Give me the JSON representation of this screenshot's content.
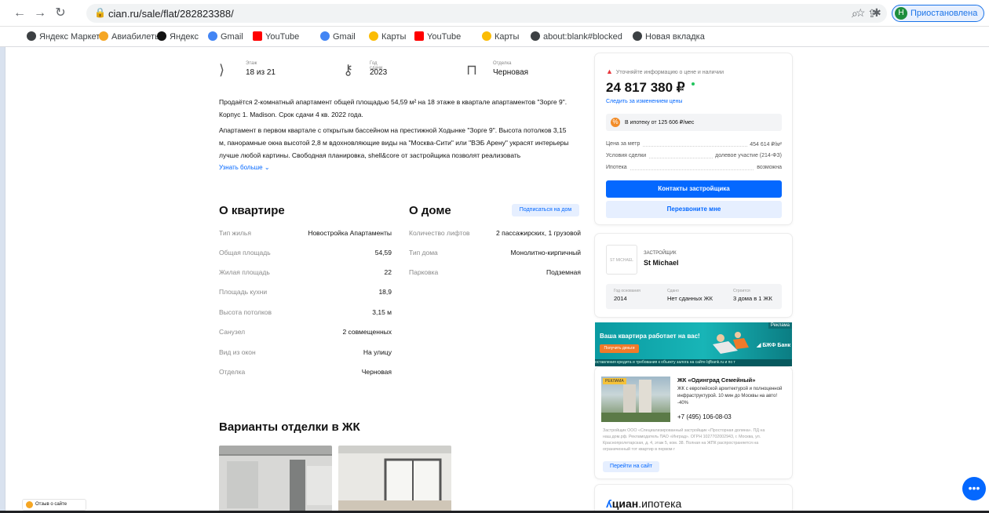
{
  "browser": {
    "url": "cian.ru/sale/flat/282823388/",
    "profile_initial": "Н",
    "profile_label": "Приостановлена",
    "bookmarks": [
      {
        "label": "Яндекс Маркет",
        "color": "#3c4043"
      },
      {
        "label": "Авиабилеты",
        "color": "#f5a623"
      },
      {
        "label": "Яндекс",
        "color": "#121212"
      },
      {
        "label": "Gmail",
        "color": "#4285f4"
      },
      {
        "label": "YouTube",
        "color": "#ff0000"
      },
      {
        "label": "Gmail",
        "color": "#4285f4"
      },
      {
        "label": "Карты",
        "color": "#fbbc04"
      },
      {
        "label": "YouTube",
        "color": "#ff0000"
      },
      {
        "label": "Карты",
        "color": "#fbbc04"
      },
      {
        "label": "about:blank#blocked",
        "color": "#3c4043"
      },
      {
        "label": "Новая вкладка",
        "color": "#3c4043"
      }
    ]
  },
  "specs": [
    {
      "key": "Этаж",
      "value": "18 из 21",
      "icon": "stairs-icon"
    },
    {
      "key": "Год сдачи",
      "value": "2023",
      "icon": "key-icon"
    },
    {
      "key": "Отделка",
      "value": "Черновая",
      "icon": "paint-roller-icon"
    }
  ],
  "description": {
    "p1": "Продаётся  2-комнатный апартамент  общей площадью 54,59 м² на 18 этаже в квартале апартаментов \"Зорге 9\". Корпус 1. Madison. Срок сдачи 4 кв. 2022 года.",
    "p2": "Апартамент в первом квартале с открытым бассейном на престижной Ходынке  \"Зорге 9\". Высота потолков 3,15 м, панорамные окна высотой 2,8 м  вдохновляющие виды на \"Москва-Сити\" или \"ВЭБ Арену\" украсят интерьеры лучше любой картины. Свободная планировка, shell&core от застройщика позволят реализовать",
    "more": "Узнать больше"
  },
  "apartment": {
    "title": "О квартире",
    "rows": [
      {
        "k": "Тип жилья",
        "v": "Новостройка Апартаменты"
      },
      {
        "k": "Общая площадь",
        "v": "54,59"
      },
      {
        "k": "Жилая площадь",
        "v": "22"
      },
      {
        "k": "Площадь кухни",
        "v": "18,9"
      },
      {
        "k": "Высота потолков",
        "v": "3,15 м"
      },
      {
        "k": "Санузел",
        "v": "2 совмещенных"
      },
      {
        "k": "Вид из окон",
        "v": "На улицу"
      },
      {
        "k": "Отделка",
        "v": "Черновая"
      }
    ]
  },
  "house": {
    "title": "О доме",
    "subscribe": "Подписаться на дом",
    "rows": [
      {
        "k": "Количество лифтов",
        "v": "2 пассажирских, 1 грузовой"
      },
      {
        "k": "Тип дома",
        "v": "Монолитно-кирпичный"
      },
      {
        "k": "Парковка",
        "v": "Подземная"
      }
    ]
  },
  "finishing": {
    "title": "Варианты отделки в ЖК"
  },
  "price_card": {
    "clarify": "Уточняйте информацию о цене и наличии",
    "price": "24 817 380 ₽",
    "track": "Следить за изменением цены",
    "mortgage": "В ипотеку от 125 606 ₽/мес",
    "rows": [
      {
        "k": "Цена за метр",
        "v": "454 614 ₽/м²"
      },
      {
        "k": "Условия сделки",
        "v": "долевое участие (214-ФЗ)"
      },
      {
        "k": "Ипотека",
        "v": "возможна"
      }
    ],
    "contacts": "Контакты застройщика",
    "callback": "Перезвоните мне"
  },
  "developer": {
    "logo_text": "ST MICHAEL",
    "label": "ЗАСТРОЙЩИК",
    "name": "St Michael",
    "stats": [
      {
        "k": "Год основания",
        "v": "2014"
      },
      {
        "k": "Сдано",
        "v": "Нет сданных ЖК"
      },
      {
        "k": "Строится",
        "v": "3 дома в 1 ЖК"
      }
    ]
  },
  "ad_banner": {
    "headline": "Ваша квартира работает на вас!",
    "button": "Получить деньги",
    "brand": "БЖФ Банк",
    "tag": "Реклама",
    "footer": "оставления кредита и требования к объекту залога на сайте bjfbank.ru и по т"
  },
  "jk_ad": {
    "tag": "РЕКЛАМА",
    "title": "ЖК «Одинград Семейный»",
    "desc": "ЖК с европейской архитектурой и полноценной инфраструктурой. 10 мин до Москвы на авто! -40%",
    "phone": "+7 (495) 106-08-03",
    "legal": "Застройщик ООО «Специализированный застройщик «Просторная долина». ПД на наш.дом.рф. Рекламодатель ПАО «Инград». ОГРН 1027702002943, г. Москва, ул. Краснопролетарская, д. 4, этаж 5, ком. 38. Полная на ЖПК распространяется на ограниченный тот квартир в первом г",
    "cta": "Перейти на сайт"
  },
  "cian_ipoteka": {
    "brand": "циан",
    "suffix": ".ипотека"
  },
  "feedback": "Отзыв о сайте"
}
